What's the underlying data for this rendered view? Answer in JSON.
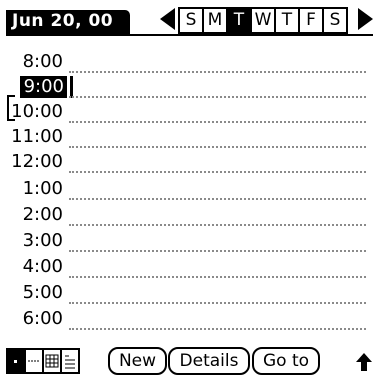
{
  "header": {
    "date": "Jun 20, 00",
    "prev_week_icon": "left-triangle-icon",
    "next_week_icon": "right-triangle-icon",
    "days": [
      "S",
      "M",
      "T",
      "W",
      "T",
      "F",
      "S"
    ],
    "selected_day_index": 2
  },
  "schedule": {
    "times": [
      "8:00",
      "9:00",
      "10:00",
      "11:00",
      "12:00",
      "1:00",
      "2:00",
      "3:00",
      "4:00",
      "5:00",
      "6:00"
    ],
    "selected_time_index": 1
  },
  "footer": {
    "view_icons": [
      "day-view-icon",
      "week-view-icon",
      "month-view-icon",
      "agenda-view-icon"
    ],
    "new_label": "New",
    "details_label": "Details",
    "goto_label": "Go to",
    "scroll_icon": "up-arrow-icon"
  }
}
